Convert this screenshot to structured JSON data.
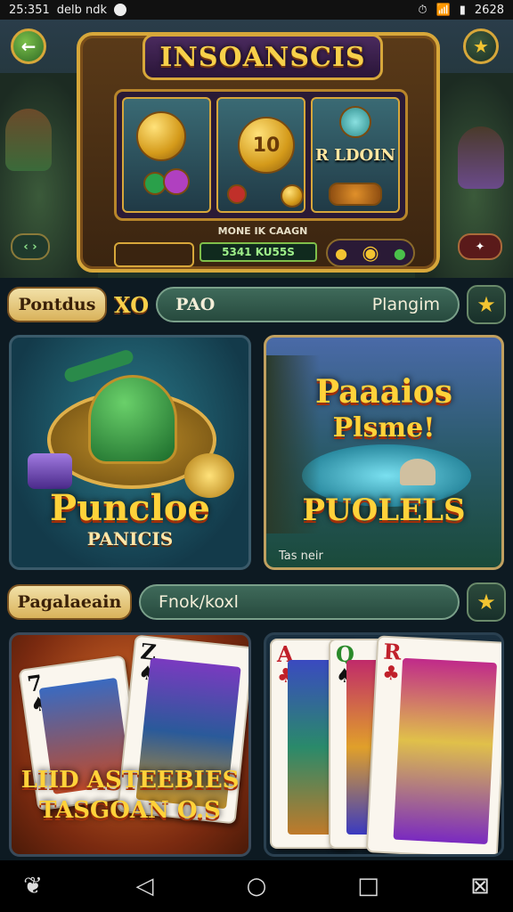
{
  "status": {
    "time": "25:351",
    "info": "delb ndk",
    "battery": "2628"
  },
  "hero": {
    "machine_title": "INSOANSCIS",
    "reel3_label": "R LDOIN",
    "reel2_coin": "10",
    "subtitle": "MONE IK CAAGN",
    "balance": "5341 KU55S"
  },
  "bar1": {
    "tag": "Pontdus",
    "multiplier": "XO",
    "search_left": "PAO",
    "search_right": "Plangim"
  },
  "game1": {
    "title": "Puncloe",
    "subtitle": "PANICIS"
  },
  "game2": {
    "title_line1": "Paaaios",
    "title_line2": "Plsme!",
    "subtitle": "PUOLELS",
    "caption": "Tas neir"
  },
  "bar2": {
    "tag": "Pagalaeain",
    "search_left": "Fnok/koxl"
  },
  "game3": {
    "title_line1": "LIID ASTEEBIES",
    "title_line2": "TASGOAN O.S"
  },
  "cards_left": [
    {
      "rank": "7",
      "suit": "♠"
    },
    {
      "rank": "Z",
      "suit": "♠"
    }
  ],
  "cards_right": [
    {
      "rank": "A",
      "suit": "♣"
    },
    {
      "rank": "Q",
      "suit": "♠"
    },
    {
      "rank": "R",
      "suit": "♣"
    }
  ]
}
